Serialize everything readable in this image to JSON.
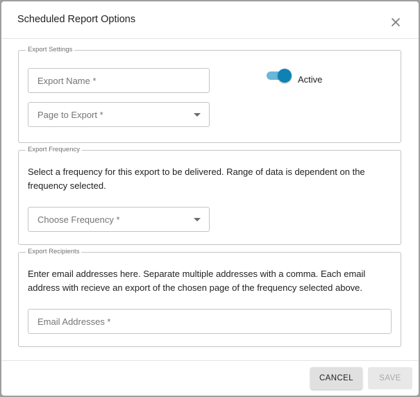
{
  "dialog": {
    "title": "Scheduled Report Options",
    "close_icon": "close-icon"
  },
  "export_settings": {
    "legend": "Export Settings",
    "export_name_placeholder": "Export Name *",
    "page_to_export_placeholder": "Page to Export *",
    "active_label": "Active",
    "active_on": true
  },
  "export_frequency": {
    "legend": "Export Frequency",
    "description": "Select a frequency for this export to be delivered. Range of data is dependent on the frequency selected.",
    "frequency_placeholder": "Choose Frequency *"
  },
  "export_recipients": {
    "legend": "Export Recipients",
    "description": "Enter email addresses here. Separate multiple addresses with a comma. Each email address with recieve an export of the chosen page of the frequency selected above.",
    "email_placeholder": "Email Addresses *"
  },
  "footer": {
    "cancel_label": "CANCEL",
    "save_label": "SAVE",
    "save_enabled": false
  },
  "colors": {
    "toggle_thumb": "#0f82b5",
    "toggle_track": "#6ab7d8"
  }
}
